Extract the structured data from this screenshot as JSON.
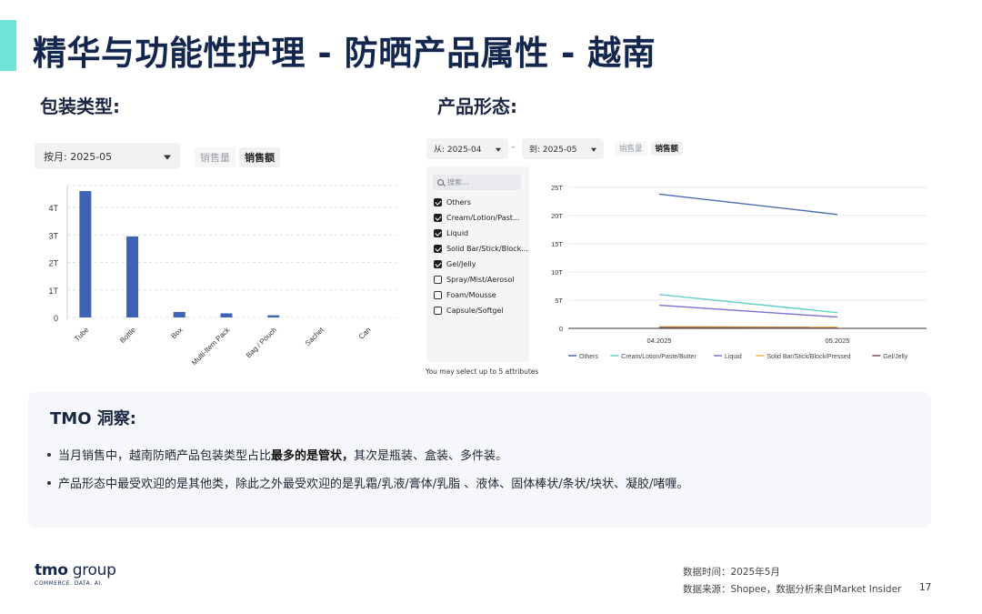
{
  "page": {
    "title": "精华与功能性护理 - 防晒产品属性 - 越南",
    "page_number": "17"
  },
  "packaging": {
    "section_title": "包装类型:",
    "month_dropdown": "按月: 2025-05",
    "toggle": {
      "volume": "销售量",
      "value": "销售额"
    }
  },
  "form": {
    "section_title": "产品形态:",
    "from_dropdown": "从: 2025-04",
    "to_dropdown": "到: 2025-05",
    "range_dash": "-",
    "toggle": {
      "volume": "销售量",
      "value": "销售额"
    },
    "search_placeholder": "搜索...",
    "filters": [
      {
        "label": "Others",
        "checked": true
      },
      {
        "label": "Cream/Lotion/Past...",
        "checked": true
      },
      {
        "label": "Liquid",
        "checked": true
      },
      {
        "label": "Solid Bar/Stick/Block...",
        "checked": true
      },
      {
        "label": "Gel/Jelly",
        "checked": true
      },
      {
        "label": "Spray/Mist/Aerosol",
        "checked": false
      },
      {
        "label": "Foam/Mousse",
        "checked": false
      },
      {
        "label": "Capsule/Softgel",
        "checked": false
      }
    ],
    "select_note": "You may select up to 5 attributes"
  },
  "chart_data": [
    {
      "type": "bar",
      "categories": [
        "Tube",
        "Bottle",
        "Box",
        "Multi-Item Pack",
        "Bag / Pouch",
        "Sachet",
        "Can"
      ],
      "values": [
        4.6,
        2.95,
        0.2,
        0.15,
        0.08,
        0,
        0
      ],
      "y_ticks": [
        "0",
        "1T",
        "2T",
        "3T",
        "4T"
      ],
      "ylim": [
        0,
        4.8
      ],
      "grid": true,
      "color": "#3f63b4"
    },
    {
      "type": "line",
      "x": [
        "04.2025",
        "05.2025"
      ],
      "y_ticks": [
        "0",
        "5T",
        "10T",
        "15T",
        "20T",
        "25T"
      ],
      "ylim": [
        0,
        25
      ],
      "grid": true,
      "legend_position": "bottom",
      "series": [
        {
          "name": "Others",
          "values": [
            23.8,
            20.2
          ],
          "color": "#4b6bb0"
        },
        {
          "name": "Cream/Lotion/Paste/Butter",
          "values": [
            6.0,
            2.8
          ],
          "color": "#5fd0c6"
        },
        {
          "name": "Liquid",
          "values": [
            4.1,
            2.0
          ],
          "color": "#7b6fd6"
        },
        {
          "name": "Solid Bar/Stick/Block/Pressed",
          "values": [
            0.3,
            0.2
          ],
          "color": "#f0b548"
        },
        {
          "name": "Gel/Jelly",
          "values": [
            0.15,
            0.1
          ],
          "color": "#7a5a52"
        }
      ]
    }
  ],
  "insights": {
    "title": "TMO 洞察:",
    "items": [
      {
        "pre": "当月销售中，越南防晒产品包装类型占比",
        "bold": "最多的是管状，",
        "post": "其次是瓶装、盒装、多件装。"
      },
      {
        "pre": "产品形态中最受欢迎的是其他类，除此之外最受欢迎的是乳霜/乳液/膏体/乳脂 、液体、固体棒状/条状/块状、凝胶/啫喱。",
        "bold": "",
        "post": ""
      }
    ]
  },
  "footer": {
    "logo_main": "tmo",
    "logo_group": " group",
    "logo_sub": "COMMERCE. DATA. AI.",
    "data_time": "数据时间：2025年5月",
    "data_source": "数据来源：Shopee，数据分析来自Market Insider"
  }
}
